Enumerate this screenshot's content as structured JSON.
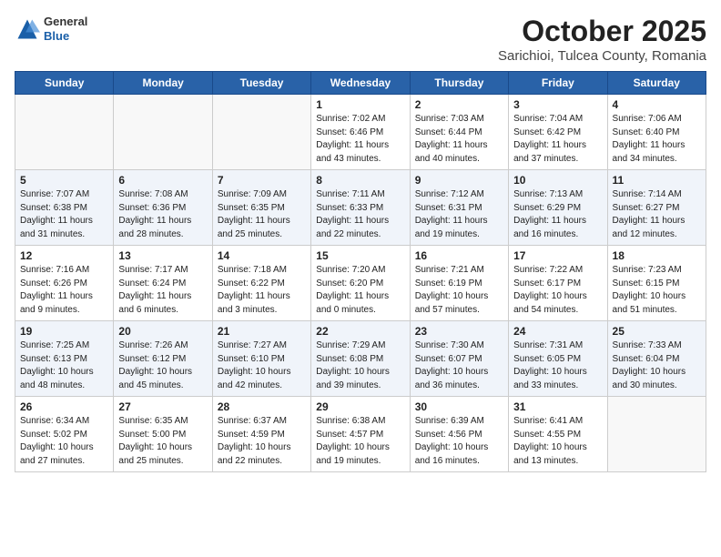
{
  "header": {
    "logo_general": "General",
    "logo_blue": "Blue",
    "month_title": "October 2025",
    "subtitle": "Sarichioi, Tulcea County, Romania"
  },
  "weekdays": [
    "Sunday",
    "Monday",
    "Tuesday",
    "Wednesday",
    "Thursday",
    "Friday",
    "Saturday"
  ],
  "weeks": [
    [
      {
        "day": "",
        "info": ""
      },
      {
        "day": "",
        "info": ""
      },
      {
        "day": "",
        "info": ""
      },
      {
        "day": "1",
        "info": "Sunrise: 7:02 AM\nSunset: 6:46 PM\nDaylight: 11 hours\nand 43 minutes."
      },
      {
        "day": "2",
        "info": "Sunrise: 7:03 AM\nSunset: 6:44 PM\nDaylight: 11 hours\nand 40 minutes."
      },
      {
        "day": "3",
        "info": "Sunrise: 7:04 AM\nSunset: 6:42 PM\nDaylight: 11 hours\nand 37 minutes."
      },
      {
        "day": "4",
        "info": "Sunrise: 7:06 AM\nSunset: 6:40 PM\nDaylight: 11 hours\nand 34 minutes."
      }
    ],
    [
      {
        "day": "5",
        "info": "Sunrise: 7:07 AM\nSunset: 6:38 PM\nDaylight: 11 hours\nand 31 minutes."
      },
      {
        "day": "6",
        "info": "Sunrise: 7:08 AM\nSunset: 6:36 PM\nDaylight: 11 hours\nand 28 minutes."
      },
      {
        "day": "7",
        "info": "Sunrise: 7:09 AM\nSunset: 6:35 PM\nDaylight: 11 hours\nand 25 minutes."
      },
      {
        "day": "8",
        "info": "Sunrise: 7:11 AM\nSunset: 6:33 PM\nDaylight: 11 hours\nand 22 minutes."
      },
      {
        "day": "9",
        "info": "Sunrise: 7:12 AM\nSunset: 6:31 PM\nDaylight: 11 hours\nand 19 minutes."
      },
      {
        "day": "10",
        "info": "Sunrise: 7:13 AM\nSunset: 6:29 PM\nDaylight: 11 hours\nand 16 minutes."
      },
      {
        "day": "11",
        "info": "Sunrise: 7:14 AM\nSunset: 6:27 PM\nDaylight: 11 hours\nand 12 minutes."
      }
    ],
    [
      {
        "day": "12",
        "info": "Sunrise: 7:16 AM\nSunset: 6:26 PM\nDaylight: 11 hours\nand 9 minutes."
      },
      {
        "day": "13",
        "info": "Sunrise: 7:17 AM\nSunset: 6:24 PM\nDaylight: 11 hours\nand 6 minutes."
      },
      {
        "day": "14",
        "info": "Sunrise: 7:18 AM\nSunset: 6:22 PM\nDaylight: 11 hours\nand 3 minutes."
      },
      {
        "day": "15",
        "info": "Sunrise: 7:20 AM\nSunset: 6:20 PM\nDaylight: 11 hours\nand 0 minutes."
      },
      {
        "day": "16",
        "info": "Sunrise: 7:21 AM\nSunset: 6:19 PM\nDaylight: 10 hours\nand 57 minutes."
      },
      {
        "day": "17",
        "info": "Sunrise: 7:22 AM\nSunset: 6:17 PM\nDaylight: 10 hours\nand 54 minutes."
      },
      {
        "day": "18",
        "info": "Sunrise: 7:23 AM\nSunset: 6:15 PM\nDaylight: 10 hours\nand 51 minutes."
      }
    ],
    [
      {
        "day": "19",
        "info": "Sunrise: 7:25 AM\nSunset: 6:13 PM\nDaylight: 10 hours\nand 48 minutes."
      },
      {
        "day": "20",
        "info": "Sunrise: 7:26 AM\nSunset: 6:12 PM\nDaylight: 10 hours\nand 45 minutes."
      },
      {
        "day": "21",
        "info": "Sunrise: 7:27 AM\nSunset: 6:10 PM\nDaylight: 10 hours\nand 42 minutes."
      },
      {
        "day": "22",
        "info": "Sunrise: 7:29 AM\nSunset: 6:08 PM\nDaylight: 10 hours\nand 39 minutes."
      },
      {
        "day": "23",
        "info": "Sunrise: 7:30 AM\nSunset: 6:07 PM\nDaylight: 10 hours\nand 36 minutes."
      },
      {
        "day": "24",
        "info": "Sunrise: 7:31 AM\nSunset: 6:05 PM\nDaylight: 10 hours\nand 33 minutes."
      },
      {
        "day": "25",
        "info": "Sunrise: 7:33 AM\nSunset: 6:04 PM\nDaylight: 10 hours\nand 30 minutes."
      }
    ],
    [
      {
        "day": "26",
        "info": "Sunrise: 6:34 AM\nSunset: 5:02 PM\nDaylight: 10 hours\nand 27 minutes."
      },
      {
        "day": "27",
        "info": "Sunrise: 6:35 AM\nSunset: 5:00 PM\nDaylight: 10 hours\nand 25 minutes."
      },
      {
        "day": "28",
        "info": "Sunrise: 6:37 AM\nSunset: 4:59 PM\nDaylight: 10 hours\nand 22 minutes."
      },
      {
        "day": "29",
        "info": "Sunrise: 6:38 AM\nSunset: 4:57 PM\nDaylight: 10 hours\nand 19 minutes."
      },
      {
        "day": "30",
        "info": "Sunrise: 6:39 AM\nSunset: 4:56 PM\nDaylight: 10 hours\nand 16 minutes."
      },
      {
        "day": "31",
        "info": "Sunrise: 6:41 AM\nSunset: 4:55 PM\nDaylight: 10 hours\nand 13 minutes."
      },
      {
        "day": "",
        "info": ""
      }
    ]
  ]
}
